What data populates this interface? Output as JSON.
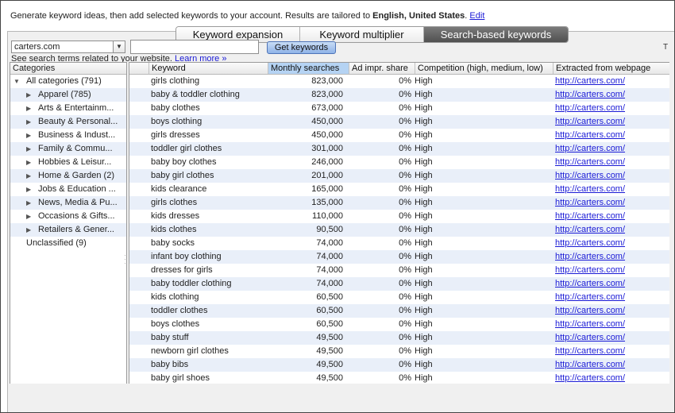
{
  "intro": {
    "text_before": "Generate keyword ideas, then add selected keywords to your account. Results are tailored to ",
    "language": "English",
    "separator": ", ",
    "country": "United States",
    "period": ".",
    "edit_link": "Edit"
  },
  "tabs": [
    {
      "label": "Keyword expansion",
      "active": false
    },
    {
      "label": "Keyword multiplier",
      "active": false
    },
    {
      "label": "Search-based keywords",
      "active": true
    }
  ],
  "description": {
    "text": "See search terms related to your website.",
    "learn_more": "Learn more »"
  },
  "site_select": {
    "value": "carters.com"
  },
  "keyword_input": {
    "value": ""
  },
  "get_keywords_button": "Get keywords",
  "cut_text": "T",
  "categories": {
    "header": "Categories",
    "items": [
      {
        "label": "All categories (791)",
        "level": 0,
        "expanded": true,
        "has_toggle": true
      },
      {
        "label": "Apparel (785)",
        "level": 1,
        "has_toggle": true
      },
      {
        "label": "Arts & Entertainm...",
        "level": 1,
        "has_toggle": true
      },
      {
        "label": "Beauty & Personal...",
        "level": 1,
        "has_toggle": true
      },
      {
        "label": "Business & Indust...",
        "level": 1,
        "has_toggle": true
      },
      {
        "label": "Family & Commu...",
        "level": 1,
        "has_toggle": true
      },
      {
        "label": "Hobbies & Leisur...",
        "level": 1,
        "has_toggle": true
      },
      {
        "label": "Home & Garden (2)",
        "level": 1,
        "has_toggle": true
      },
      {
        "label": "Jobs & Education ...",
        "level": 1,
        "has_toggle": true
      },
      {
        "label": "News, Media & Pu...",
        "level": 1,
        "has_toggle": true
      },
      {
        "label": "Occasions & Gifts...",
        "level": 1,
        "has_toggle": true
      },
      {
        "label": "Retailers & Gener...",
        "level": 1,
        "has_toggle": true
      },
      {
        "label": "Unclassified (9)",
        "level": 0,
        "has_toggle": false
      }
    ]
  },
  "table": {
    "columns": [
      "Keyword",
      "Monthly searches",
      "Ad impr. share",
      "Competition (high, medium, low)",
      "Extracted from webpage"
    ],
    "sorted_column": "Monthly searches",
    "rows": [
      {
        "keyword": "girls clothing",
        "monthly": "823,000",
        "share": "0%",
        "competition": "High",
        "source": "http://carters.com/"
      },
      {
        "keyword": "baby & toddler clothing",
        "monthly": "823,000",
        "share": "0%",
        "competition": "High",
        "source": "http://carters.com/"
      },
      {
        "keyword": "baby clothes",
        "monthly": "673,000",
        "share": "0%",
        "competition": "High",
        "source": "http://carters.com/"
      },
      {
        "keyword": "boys clothing",
        "monthly": "450,000",
        "share": "0%",
        "competition": "High",
        "source": "http://carters.com/"
      },
      {
        "keyword": "girls dresses",
        "monthly": "450,000",
        "share": "0%",
        "competition": "High",
        "source": "http://carters.com/"
      },
      {
        "keyword": "toddler girl clothes",
        "monthly": "301,000",
        "share": "0%",
        "competition": "High",
        "source": "http://carters.com/"
      },
      {
        "keyword": "baby boy clothes",
        "monthly": "246,000",
        "share": "0%",
        "competition": "High",
        "source": "http://carters.com/"
      },
      {
        "keyword": "baby girl clothes",
        "monthly": "201,000",
        "share": "0%",
        "competition": "High",
        "source": "http://carters.com/"
      },
      {
        "keyword": "kids clearance",
        "monthly": "165,000",
        "share": "0%",
        "competition": "High",
        "source": "http://carters.com/"
      },
      {
        "keyword": "girls clothes",
        "monthly": "135,000",
        "share": "0%",
        "competition": "High",
        "source": "http://carters.com/"
      },
      {
        "keyword": "kids dresses",
        "monthly": "110,000",
        "share": "0%",
        "competition": "High",
        "source": "http://carters.com/"
      },
      {
        "keyword": "kids clothes",
        "monthly": "90,500",
        "share": "0%",
        "competition": "High",
        "source": "http://carters.com/"
      },
      {
        "keyword": "baby socks",
        "monthly": "74,000",
        "share": "0%",
        "competition": "High",
        "source": "http://carters.com/"
      },
      {
        "keyword": "infant boy clothing",
        "monthly": "74,000",
        "share": "0%",
        "competition": "High",
        "source": "http://carters.com/"
      },
      {
        "keyword": "dresses for girls",
        "monthly": "74,000",
        "share": "0%",
        "competition": "High",
        "source": "http://carters.com/"
      },
      {
        "keyword": "baby toddler clothing",
        "monthly": "74,000",
        "share": "0%",
        "competition": "High",
        "source": "http://carters.com/"
      },
      {
        "keyword": "kids clothing",
        "monthly": "60,500",
        "share": "0%",
        "competition": "High",
        "source": "http://carters.com/"
      },
      {
        "keyword": "toddler clothes",
        "monthly": "60,500",
        "share": "0%",
        "competition": "High",
        "source": "http://carters.com/"
      },
      {
        "keyword": "boys clothes",
        "monthly": "60,500",
        "share": "0%",
        "competition": "High",
        "source": "http://carters.com/"
      },
      {
        "keyword": "baby stuff",
        "monthly": "49,500",
        "share": "0%",
        "competition": "High",
        "source": "http://carters.com/"
      },
      {
        "keyword": "newborn girl clothes",
        "monthly": "49,500",
        "share": "0%",
        "competition": "High",
        "source": "http://carters.com/"
      },
      {
        "keyword": "baby bibs",
        "monthly": "49,500",
        "share": "0%",
        "competition": "High",
        "source": "http://carters.com/"
      },
      {
        "keyword": "baby girl shoes",
        "monthly": "49,500",
        "share": "0%",
        "competition": "High",
        "source": "http://carters.com/"
      }
    ]
  },
  "colors": {
    "accent_tab": "#505050",
    "sorted_header": "#b5d3f3",
    "alt_row": "#e9eff9",
    "link": "#1a1ad6",
    "button": "#8fb3e8"
  }
}
